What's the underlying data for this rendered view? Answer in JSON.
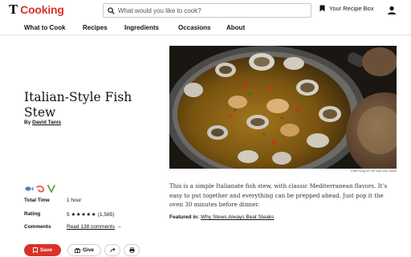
{
  "header": {
    "logo_mark": "T",
    "logo_word": "Cooking",
    "search_placeholder": "What would you like to cook?",
    "recipe_box_label": "Your Recipe Box",
    "icons": {
      "search": "search-icon",
      "bookmark": "bookmark-icon",
      "account": "account-icon"
    }
  },
  "nav": {
    "items": [
      "What to Cook",
      "Recipes",
      "Ingredients",
      "Occasions",
      "About"
    ]
  },
  "recipe": {
    "title": "Italian-Style Fish Stew",
    "byline_prefix": "By ",
    "author": "David Tanis",
    "diet_icons": [
      "fish-icon",
      "shrimp-icon",
      "vegetable-icon"
    ],
    "meta": {
      "total_time_label": "Total Time",
      "total_time_value": "1 hour",
      "rating_label": "Rating",
      "rating_value": "5",
      "rating_stars": 5,
      "rating_count": "(1,585)",
      "comments_label": "Comments",
      "comments_link": "Read 138 comments"
    },
    "actions": {
      "save_label": "Save",
      "give_label": "Give"
    },
    "photo_credit": "Evan Sung for The New York Times",
    "description": "This is a simple Italianate fish stew, with classic Mediterranean flavors. It’s easy to put together and everything can be prepped ahead. Just pop it the oven 30 minutes before dinner.",
    "featured_label": "Featured in:",
    "featured_link": "Why Stews Always Beat Steaks"
  },
  "colors": {
    "brand_red": "#d8312a",
    "text": "#121212"
  }
}
